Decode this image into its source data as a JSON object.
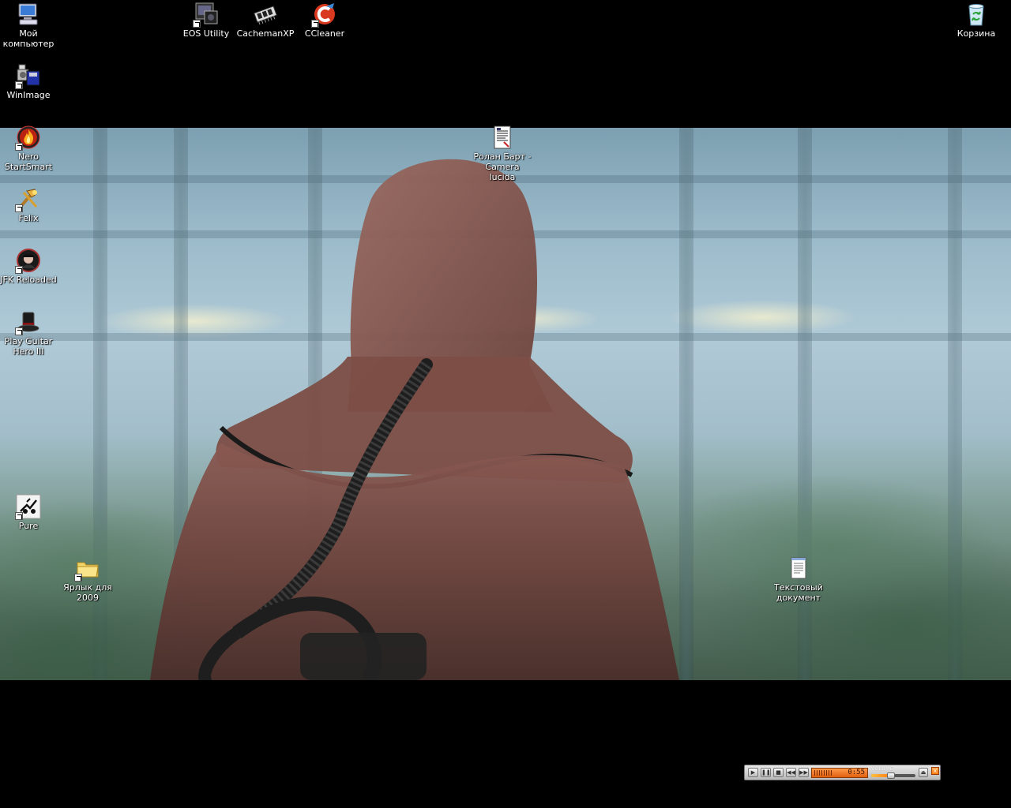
{
  "desktop": {
    "icons": [
      {
        "name": "my-computer",
        "label": "Мой компьютер",
        "icon": "computer-icon"
      },
      {
        "name": "eos-utility",
        "label": "EOS Utility",
        "icon": "camera-utility-icon"
      },
      {
        "name": "cachemanxp",
        "label": "CachemanXP",
        "icon": "memory-chip-icon"
      },
      {
        "name": "ccleaner",
        "label": "CCleaner",
        "icon": "ccleaner-icon"
      },
      {
        "name": "recycle-bin",
        "label": "Корзина",
        "icon": "recycle-bin-icon"
      },
      {
        "name": "winimage",
        "label": "WinImage",
        "icon": "disk-image-icon"
      },
      {
        "name": "nero-startsmart",
        "label": "Nero StartSmart",
        "icon": "nero-flame-icon"
      },
      {
        "name": "felix",
        "label": "Felix",
        "icon": "tools-icon"
      },
      {
        "name": "jfk-reloaded",
        "label": "JFK Reloaded",
        "icon": "jfk-icon"
      },
      {
        "name": "guitar-hero",
        "label": "Play Guitar Hero III",
        "icon": "top-hat-icon"
      },
      {
        "name": "pure",
        "label": "Pure",
        "icon": "pure-icon"
      },
      {
        "name": "shortcut-2009",
        "label": "Ярлык для 2009",
        "icon": "folder-icon"
      },
      {
        "name": "roland-barthes",
        "label": "Ролан Барт - Camera lucida",
        "icon": "document-icon"
      },
      {
        "name": "text-document",
        "label": "Текстовый документ",
        "icon": "notepad-icon"
      }
    ]
  },
  "media_player": {
    "time": "0:55",
    "volume_label": "VOLUME",
    "volume_level": 0.45,
    "buttons": [
      "play",
      "pause",
      "stop",
      "previous",
      "next"
    ],
    "colors": {
      "display": "#ff8a30",
      "body": "#c8c8c8"
    }
  }
}
